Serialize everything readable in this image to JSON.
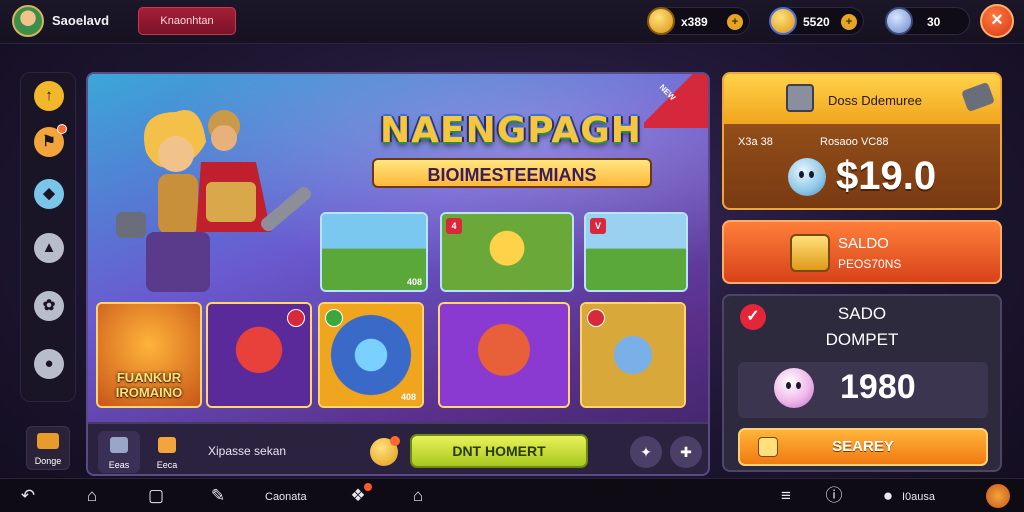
{
  "topbar": {
    "player_name": "Saoelavd",
    "badge_label": "Knaonhtan",
    "resources": [
      {
        "icon": "gold-coin-icon",
        "value": "x389",
        "color": "#e7a526"
      },
      {
        "icon": "coin-bag-icon",
        "value": "5520",
        "color": "#e7a526"
      },
      {
        "icon": "gem-icon",
        "value": "30",
        "color": "#7aa8e8"
      }
    ],
    "close_icon": "close-icon"
  },
  "sidebar": {
    "items": [
      {
        "icon": "arrow-up-icon",
        "color": "#f2b72a"
      },
      {
        "icon": "flag-icon",
        "color": "#f2a53a",
        "badge": true
      },
      {
        "icon": "drop-icon",
        "color": "#7ac6e8"
      },
      {
        "icon": "shop-icon",
        "color": "#b8bccb"
      },
      {
        "icon": "gear-icon",
        "color": "#b8bccb"
      },
      {
        "icon": "bomb-icon",
        "color": "#b8bccb"
      }
    ],
    "bottom_button": "Donge"
  },
  "main": {
    "title": "NAENGPAGH",
    "subtitle": "BIOIMESTEEMIANS",
    "ribbon": "NEW",
    "tiles": [
      {
        "tag": "",
        "number": "408"
      },
      {
        "tag": "4",
        "number": ""
      },
      {
        "tag": "V",
        "number": ""
      }
    ],
    "cards": [
      {
        "caption_line1": "FUANKUR",
        "caption_line2": "IROMAINO",
        "number": ""
      },
      {
        "caption_line1": "",
        "caption_line2": "",
        "number": ""
      },
      {
        "caption_line1": "",
        "caption_line2": "",
        "number": "408"
      },
      {
        "caption_line1": "",
        "caption_line2": "",
        "number": ""
      },
      {
        "caption_line1": "",
        "caption_line2": "",
        "number": ""
      }
    ],
    "footer": {
      "btn1_label": "Eeas",
      "btn2_label": "Eeca",
      "label": "Xipasse sekan",
      "play_label": "DNT HOMERT"
    }
  },
  "right": {
    "panel1": {
      "title": "Doss Ddemuree",
      "label_left": "X3a 38",
      "label_right": "Rosaoo VC88",
      "value": "$19.0"
    },
    "panel2": {
      "title": "SALDO",
      "subtitle": "PEOS70NS"
    },
    "panel3": {
      "title_line1": "SADO",
      "title_line2": "DOMPET",
      "value": "1980",
      "button": "SEAREY"
    }
  },
  "navbar": {
    "items": [
      {
        "icon": "back-icon",
        "label": ""
      },
      {
        "icon": "home-icon",
        "label": ""
      },
      {
        "icon": "window-icon",
        "label": ""
      },
      {
        "icon": "pen-icon",
        "label": ""
      },
      {
        "icon": "",
        "label": "Caonata"
      },
      {
        "icon": "gem-nav-icon",
        "label": ""
      },
      {
        "icon": "house-icon",
        "label": ""
      },
      {
        "icon": "list-icon",
        "label": ""
      },
      {
        "icon": "info-icon",
        "label": ""
      },
      {
        "icon": "bomb-nav-icon",
        "label": "I0ausa"
      },
      {
        "icon": "profile-icon",
        "label": ""
      }
    ]
  }
}
